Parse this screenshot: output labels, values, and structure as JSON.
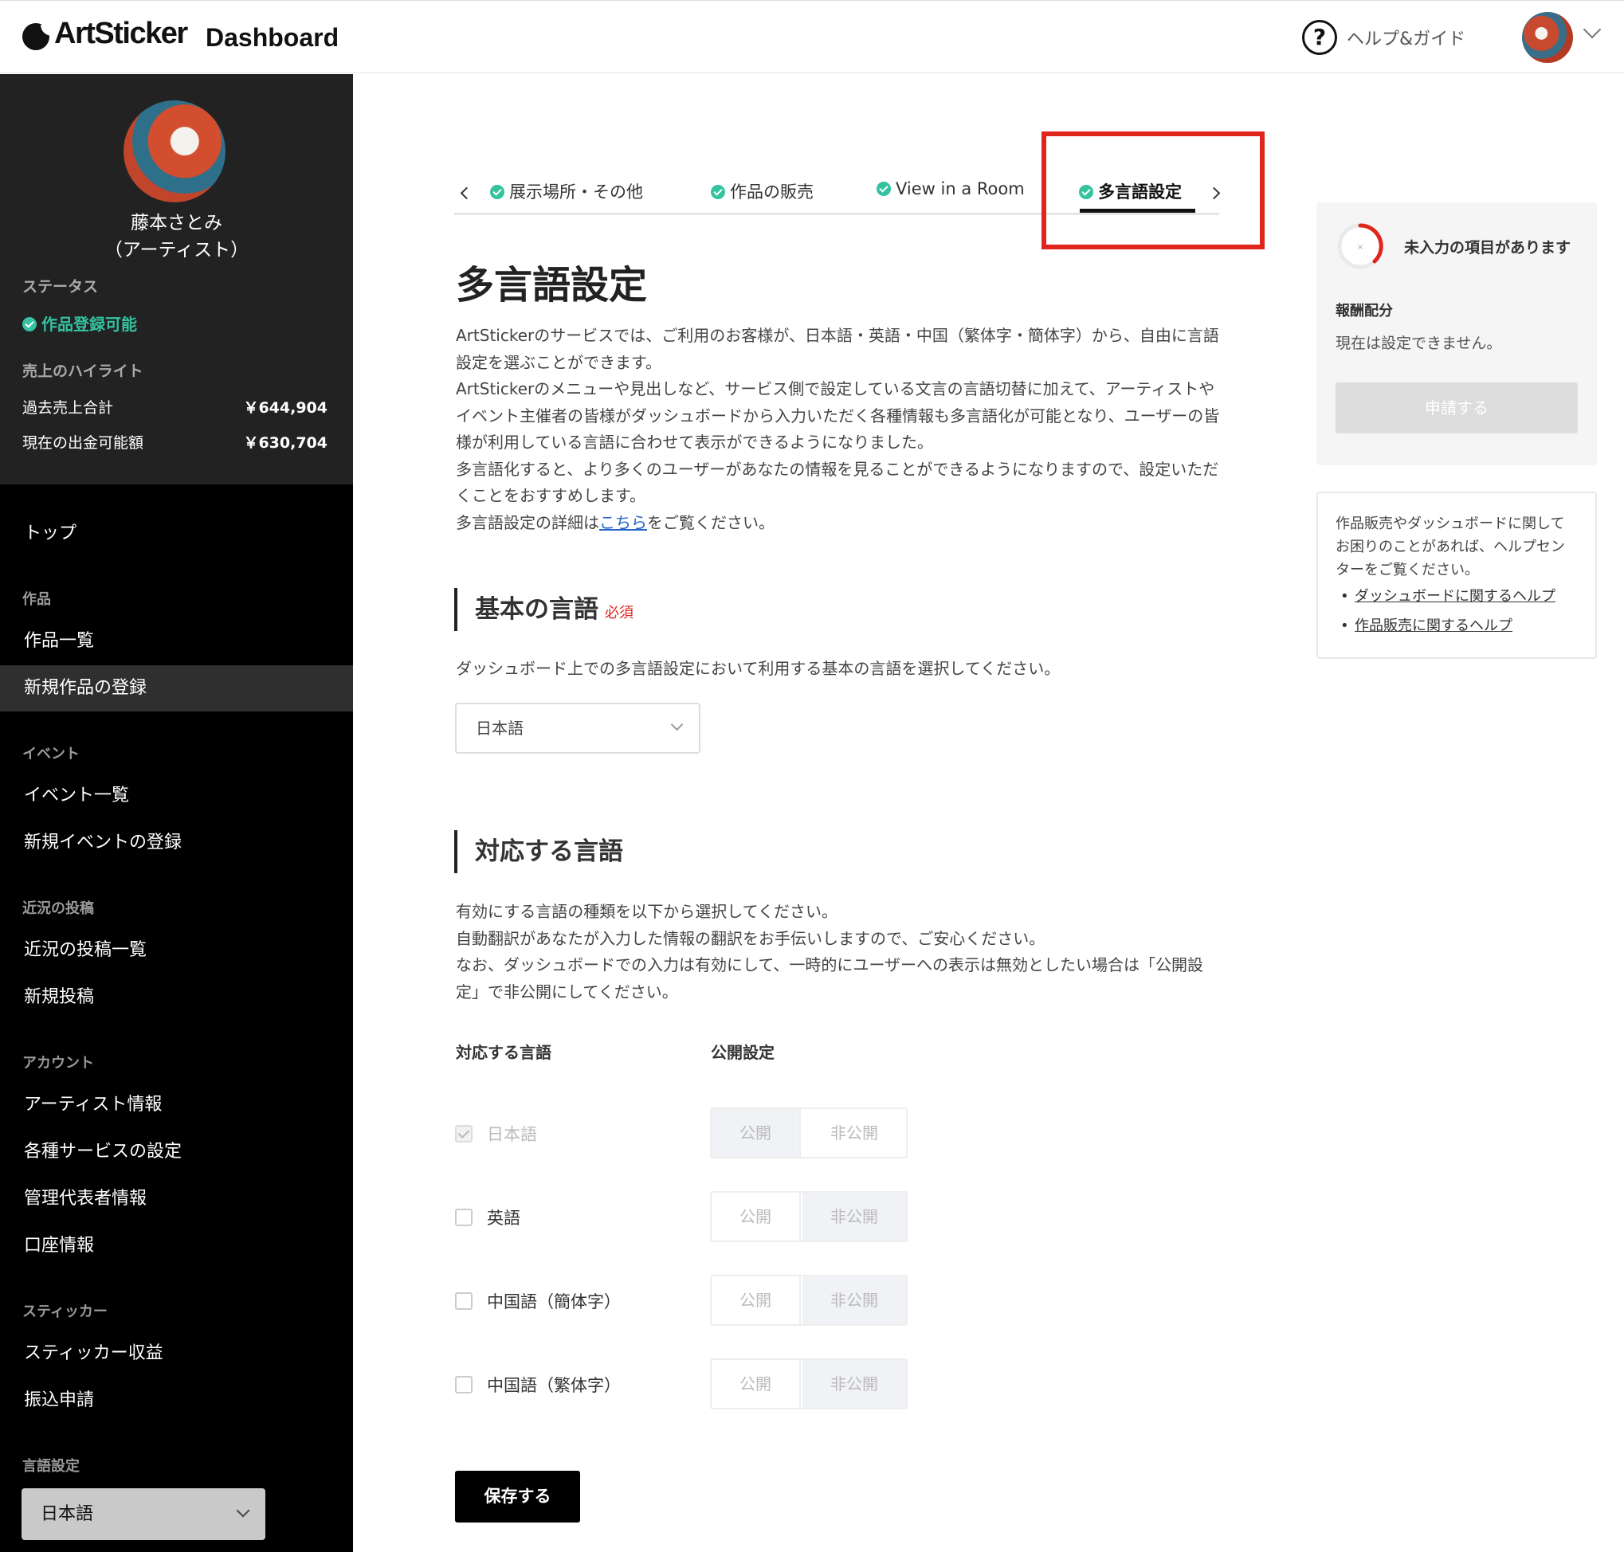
{
  "header": {
    "logo_text": "ArtSticker",
    "title": "Dashboard",
    "help_label": "ヘルプ&ガイド"
  },
  "sidebar": {
    "artist_name_line1": "藤本さとみ",
    "artist_name_line2": "（アーティスト）",
    "status_label": "ステータス",
    "status_value": "作品登録可能",
    "sales_label": "売上のハイライト",
    "stats": [
      {
        "label": "過去売上合計",
        "value": "￥644,904"
      },
      {
        "label": "現在の出金可能額",
        "value": "￥630,704"
      }
    ],
    "nav": {
      "top": "トップ",
      "works_section": "作品",
      "works_list": "作品一覧",
      "new_work": "新規作品の登録",
      "events_section": "イベント",
      "events_list": "イベント一覧",
      "new_event": "新規イベントの登録",
      "posts_section": "近況の投稿",
      "posts_list": "近況の投稿一覧",
      "new_post": "新規投稿",
      "account_section": "アカウント",
      "artist_info": "アーティスト情報",
      "services": "各種サービスの設定",
      "manager": "管理代表者情報",
      "bank": "口座情報",
      "sticker_section": "スティッカー",
      "sticker_income": "スティッカー収益",
      "transfer": "振込申請",
      "language_section": "言語設定",
      "language_value": "日本語"
    }
  },
  "tabs": [
    {
      "label": "展示場所・その他"
    },
    {
      "label": "作品の販売"
    },
    {
      "label": "View in a Room"
    },
    {
      "label": "多言語設定"
    }
  ],
  "main": {
    "title": "多言語設定",
    "intro_1": "ArtStickerのサービスでは、ご利用のお客様が、日本語・英語・中国（繁体字・簡体字）から、自由に言語設定を選ぶことができます。",
    "intro_2": "ArtStickerのメニューや見出しなど、サービス側で設定している文言の言語切替に加えて、アーティストやイベント主催者の皆様がダッシュボードから入力いただく各種情報も多言語化が可能となり、ユーザーの皆様が利用している言語に合わせて表示ができるようになりました。",
    "intro_3": "多言語化すると、より多くのユーザーがあなたの情報を見ることができるようになりますので、設定いただくことをおすすめします。",
    "intro_4_pre": "多言語設定の詳細は",
    "intro_4_link": "こちら",
    "intro_4_post": "をご覧ください。",
    "base_heading": "基本の言語",
    "required": "必須",
    "base_desc": "ダッシュボード上での多言語設定において利用する基本の言語を選択してください。",
    "base_value": "日本語",
    "supported_heading": "対応する言語",
    "supported_desc_1": "有効にする言語の種類を以下から選択してください。",
    "supported_desc_2": "自動翻訳があなたが入力した情報の翻訳をお手伝いしますので、ご安心ください。",
    "supported_desc_3": "なお、ダッシュボードでの入力は有効にして、一時的にユーザーへの表示は無効としたい場合は「公開設定」で非公開にしてください。",
    "col_language": "対応する言語",
    "col_visibility": "公開設定",
    "public_label": "公開",
    "private_label": "非公開",
    "languages": [
      {
        "label": "日本語",
        "checked": true,
        "visibility": "公開"
      },
      {
        "label": "英語",
        "checked": false,
        "visibility": "非公開"
      },
      {
        "label": "中国語（簡体字）",
        "checked": false,
        "visibility": "非公開"
      },
      {
        "label": "中国語（繁体字）",
        "checked": false,
        "visibility": "非公開"
      }
    ],
    "save_label": "保存する"
  },
  "right_panel": {
    "missing_text": "未入力の項目があります",
    "progress_mark": "×",
    "reward_label": "報酬配分",
    "reward_desc": "現在は設定できません。",
    "apply_label": "申請する",
    "help_desc": "作品販売やダッシュボードに関してお困りのことがあれば、ヘルプセンターをご覧ください。",
    "help_links": [
      "ダッシュボードに関するヘルプ",
      "作品販売に関するヘルプ"
    ]
  },
  "colors": {
    "accent_green": "#35c2a0",
    "highlight_red": "#e0261c",
    "link_blue": "#2563c9",
    "sidebar_bg": "#000000"
  }
}
